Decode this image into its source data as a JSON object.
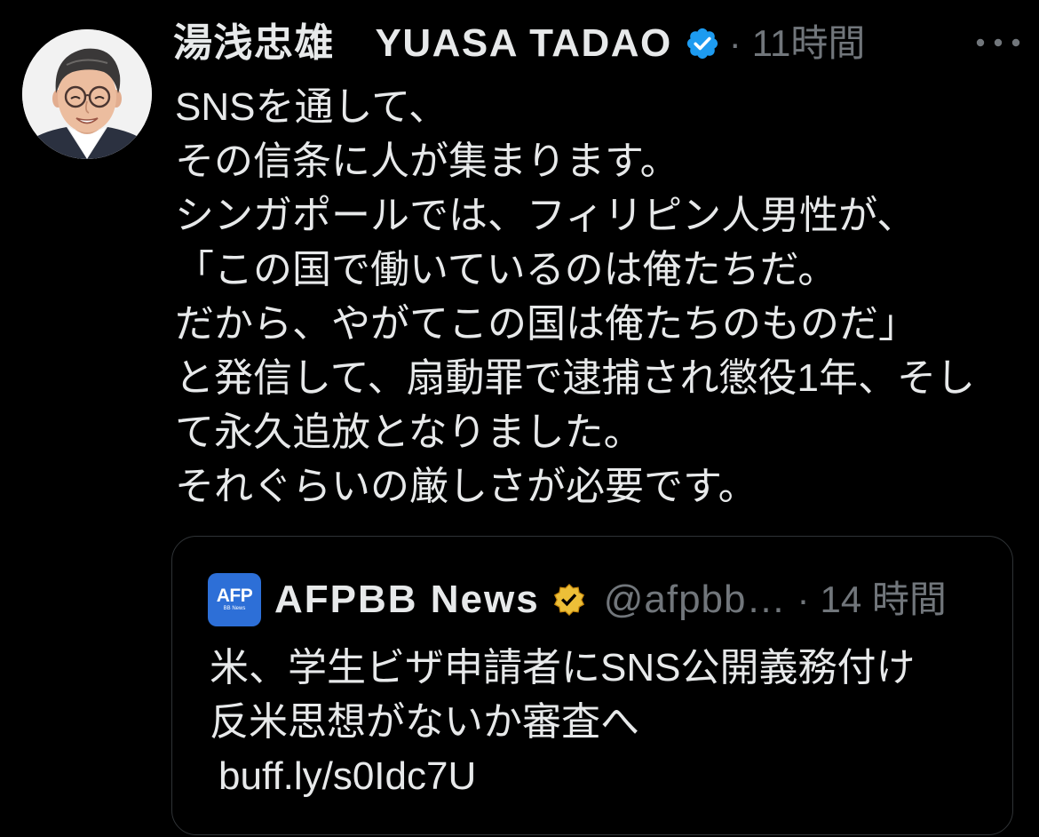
{
  "theme": {
    "background": "#000000",
    "text_primary": "#e7e9ea",
    "text_secondary": "#71767b",
    "border": "#2f3336"
  },
  "tweet": {
    "avatar_icon": "avatar-photo",
    "author_name": "湯浅忠雄　YUASA TADAO",
    "verified_icon": "verified-badge-icon",
    "verified_color": "#1d9bf0",
    "separator": "·",
    "timestamp": "11時間",
    "more_icon": "more-icon",
    "body_lines": [
      "SNSを通して、",
      "その信条に人が集まります。",
      "シンガポールでは、フィリピン人男性が、",
      "「この国で働いているのは俺たちだ。",
      "だから、やがてこの国は俺たちのものだ」",
      "と発信して、扇動罪で逮捕され懲役1年、そし",
      "て永久追放となりました。",
      "それぐらいの厳しさが必要です。"
    ],
    "quote": {
      "logo_icon": "afp-logo",
      "logo_text": "AFP",
      "logo_subtext": "BB News",
      "logo_color": "#2d6fd7",
      "author_name": "AFPBB News",
      "verified_icon": "gold-verified-badge-icon",
      "verified_color": "#ecbf38",
      "handle": "@afpbb…",
      "separator": "·",
      "timestamp": "14 時間",
      "text_lines": [
        "米、学生ビザ申請者にSNS公開義務付け",
        "反米思想がないか審査へ",
        "buff.ly/s0Idc7U"
      ]
    }
  }
}
